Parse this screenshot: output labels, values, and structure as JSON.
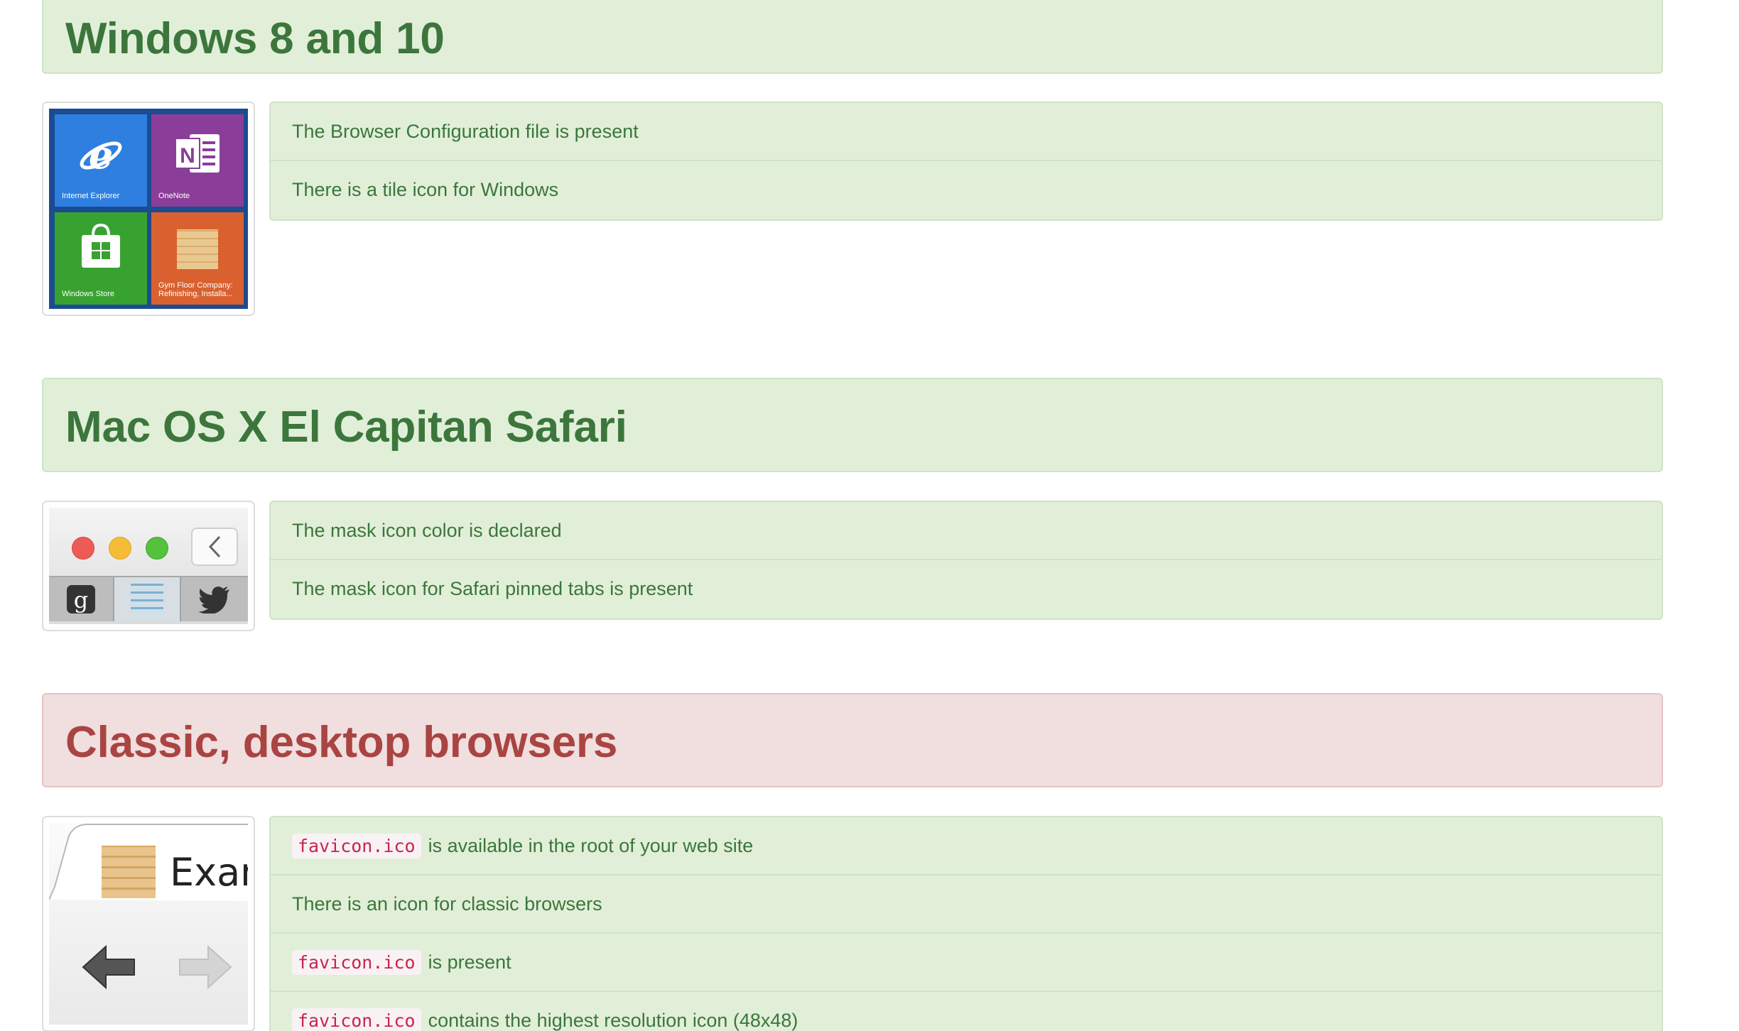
{
  "sections": [
    {
      "title": "Windows 8 and 10",
      "status": "success",
      "thumbnail": {
        "kind": "windows-tiles",
        "tiles": [
          {
            "label": "Internet Explorer",
            "color": "#2f7fe0",
            "icon": "internet-explorer-icon"
          },
          {
            "label": "OneNote",
            "color": "#8a3e99",
            "icon": "onenote-icon"
          },
          {
            "label": "Windows Store",
            "color": "#38a230",
            "icon": "windows-store-icon"
          },
          {
            "label": "Gym Floor Company: Refinishing, Installa...",
            "color": "#d9612f",
            "icon": "wood-favicon-icon"
          }
        ]
      },
      "checks": [
        {
          "code": "",
          "text": "The Browser Configuration file is present"
        },
        {
          "code": "",
          "text": "There is a tile icon for Windows"
        }
      ]
    },
    {
      "title": "Mac OS X El Capitan Safari",
      "status": "success",
      "thumbnail": {
        "kind": "safari-pinned-tabs",
        "window_buttons": [
          "#ee5b54",
          "#f5bd37",
          "#54c13f"
        ],
        "pinned_tabs": [
          "google-icon",
          "wood-favicon-icon",
          "twitter-icon"
        ]
      },
      "checks": [
        {
          "code": "",
          "text": "The mask icon color is declared"
        },
        {
          "code": "",
          "text": "The mask icon for Safari pinned tabs is present"
        }
      ]
    },
    {
      "title": "Classic, desktop browsers",
      "status": "danger",
      "thumbnail": {
        "kind": "classic-browser-tab",
        "tab_text": "Exan"
      },
      "checks": [
        {
          "code": "favicon.ico",
          "text": "is available in the root of your web site"
        },
        {
          "code": "",
          "text": "There is an icon for classic browsers"
        },
        {
          "code": "favicon.ico",
          "text": "is present"
        },
        {
          "code": "favicon.ico",
          "text": "contains the highest resolution icon (48x48)"
        }
      ]
    }
  ],
  "colors": {
    "success_bg": "#e1efd8",
    "success_border": "#cfe3c6",
    "success_text": "#3c763d",
    "danger_bg": "#f1dede",
    "danger_border": "#e7c3c6",
    "danger_text": "#a94442",
    "code_text": "#c7254e",
    "code_bg": "#f9f2f4"
  }
}
